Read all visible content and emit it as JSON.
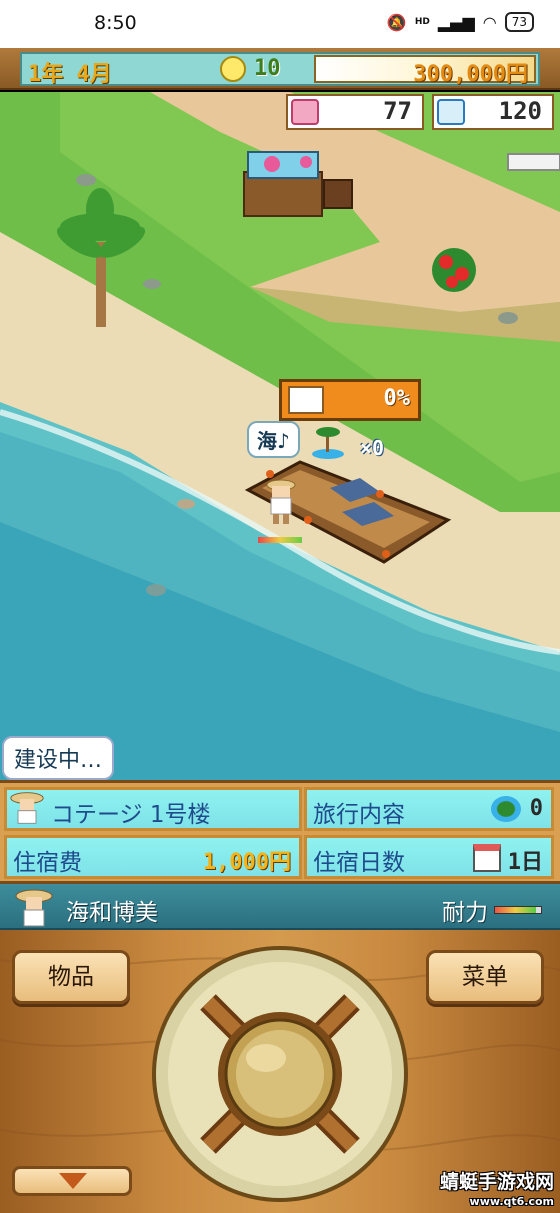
{
  "status_bar": {
    "time": "8:50",
    "network": "HD",
    "battery": "73"
  },
  "hud": {
    "date": "1年 4月",
    "ideas": "10",
    "money": "300,000円"
  },
  "stats": {
    "love": "77",
    "water": "120"
  },
  "construction": {
    "progress": "0%",
    "progress_fraction": 0.0,
    "bubble": "海♪",
    "tour_count": "×0",
    "status_bubble": "建设中…"
  },
  "info": {
    "building_name": "コテージ 1号楼",
    "tour_label": "旅行内容",
    "tour_value": "0",
    "fee_label": "住宿费",
    "fee_value": "1,000円",
    "days_label": "住宿日数",
    "days_value": "1日"
  },
  "character": {
    "name": "海和博美",
    "stamina_label": "耐力",
    "stamina_fraction": 0.9
  },
  "controls": {
    "items_label": "物品",
    "menu_label": "菜单"
  },
  "watermark": {
    "title": "蜻蜓手游戏网",
    "url": "www.qt6.com"
  },
  "colors": {
    "hud_bg": "#8fd7d2",
    "info_cell": "#8ff2f0",
    "char_bar": "#3e8e9c",
    "wood": "#c98a40",
    "progress": "#f08b1e"
  }
}
